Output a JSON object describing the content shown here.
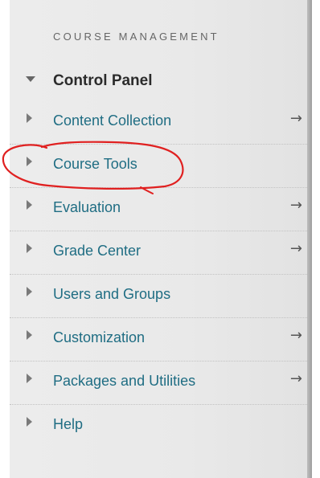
{
  "section": {
    "title": "COURSE MANAGEMENT"
  },
  "control_panel": {
    "label": "Control Panel"
  },
  "items": [
    {
      "label": "Content Collection",
      "has_arrow": true
    },
    {
      "label": "Course Tools",
      "has_arrow": false
    },
    {
      "label": "Evaluation",
      "has_arrow": true
    },
    {
      "label": "Grade Center",
      "has_arrow": true
    },
    {
      "label": "Users and Groups",
      "has_arrow": false
    },
    {
      "label": "Customization",
      "has_arrow": true
    },
    {
      "label": "Packages and Utilities",
      "has_arrow": true
    },
    {
      "label": "Help",
      "has_arrow": false
    }
  ],
  "arrow_glyph": "→",
  "colors": {
    "link": "#1f6d83",
    "annotation": "#e02020"
  },
  "icons": {
    "collapse": "chevron-down-icon",
    "expand": "chevron-right-icon",
    "go": "arrow-right-icon"
  }
}
